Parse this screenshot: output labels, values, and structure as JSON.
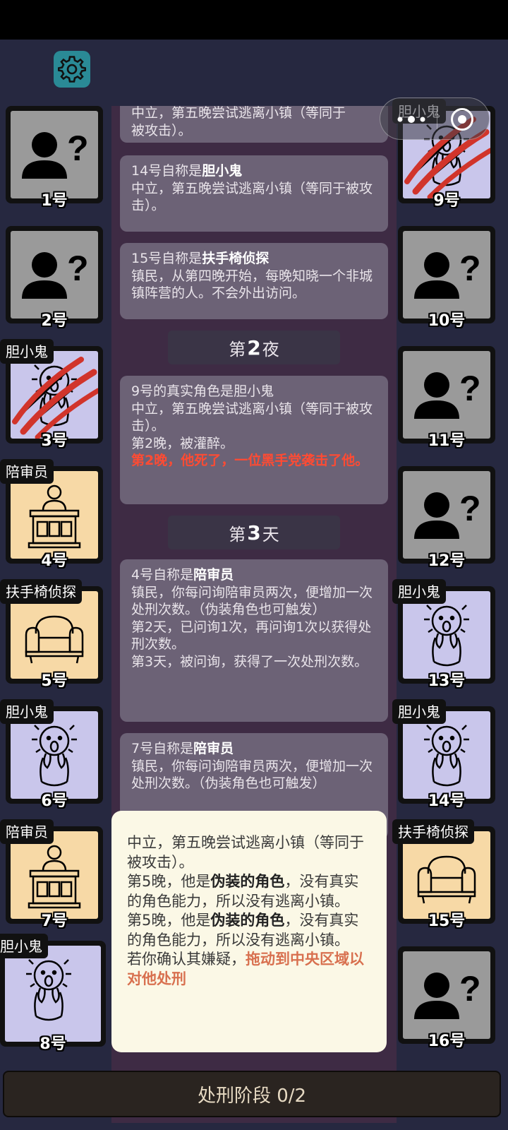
{
  "settings": {
    "icon": "gear-icon"
  },
  "capsule": {
    "more_icon": "more-dots-icon",
    "close_icon": "close-circle-icon"
  },
  "log": {
    "entry_top": {
      "line1": "中立，第五晚尝试逃离小镇（等同于",
      "line2": "被攻击）。"
    },
    "entry_14": {
      "prefix": "14号自称是",
      "role": "胆小鬼",
      "desc": "中立，第五晚尝试逃离小镇（等同于被攻击）。"
    },
    "entry_15": {
      "prefix": "15号自称是",
      "role": "扶手椅侦探",
      "desc": "镇民，从第四晚开始，每晚知晓一个非城镇阵营的人。不会外出访问。"
    },
    "night2": {
      "pre": "第",
      "num": "2",
      "post": "夜"
    },
    "entry_9": {
      "line1": "9号的真实角色是胆小鬼",
      "desc": "中立，第五晚尝试逃离小镇（等同于被攻击）。",
      "line3": "第2晚，被灌醉。",
      "red": "第2晚，他死了，一位黑手党袭击了他。"
    },
    "day3": {
      "pre": "第",
      "num": "3",
      "post": "天"
    },
    "entry_4": {
      "prefix": "4号自称是",
      "role": "陪审员",
      "desc": "镇民，你每问询陪审员两次，便增加一次处刑次数。（伪装角色也可触发）",
      "line3": "第2天，已问询1次，再问询1次以获得处刑次数。",
      "line4": "第3天，被问询，获得了一次处刑次数。"
    },
    "entry_7": {
      "prefix": "7号自称是",
      "role": "陪审员",
      "desc": "镇民，你每问询陪审员两次，便增加一次处刑次数。（伪装角色也可触发）"
    }
  },
  "players": [
    {
      "num": "1号",
      "tag": "",
      "type": "unknown"
    },
    {
      "num": "2号",
      "tag": "",
      "type": "unknown"
    },
    {
      "num": "3号",
      "tag": "胆小鬼",
      "type": "coward",
      "dead": true
    },
    {
      "num": "4号",
      "tag": "陪审员",
      "type": "juror"
    },
    {
      "num": "5号",
      "tag": "扶手椅侦探",
      "type": "armchair"
    },
    {
      "num": "6号",
      "tag": "胆小鬼",
      "type": "coward"
    },
    {
      "num": "7号",
      "tag": "陪审员",
      "type": "juror"
    },
    {
      "num": "8号",
      "tag": "胆小鬼",
      "type": "coward",
      "selected": true
    },
    {
      "num": "9号",
      "tag": "胆小鬼",
      "type": "coward",
      "dead": true
    },
    {
      "num": "10号",
      "tag": "",
      "type": "unknown"
    },
    {
      "num": "11号",
      "tag": "",
      "type": "unknown"
    },
    {
      "num": "12号",
      "tag": "",
      "type": "unknown"
    },
    {
      "num": "13号",
      "tag": "胆小鬼",
      "type": "coward"
    },
    {
      "num": "14号",
      "tag": "胆小鬼",
      "type": "coward"
    },
    {
      "num": "15号",
      "tag": "扶手椅侦探",
      "type": "armchair"
    },
    {
      "num": "16号",
      "tag": "",
      "type": "unknown"
    }
  ],
  "popup": {
    "line1": "中立，第五晚尝试逃离小镇（等同于被攻击）。",
    "p2_pre": "第5晚，他是",
    "p2_bold": "伪装的角色",
    "p2_post": "，没有真实的角色能力，所以没有逃离小镇。",
    "p3_pre": "第5晚，他是",
    "p3_bold": "伪装的角色",
    "p3_post": "，没有真实的角色能力，所以没有逃离小镇。",
    "p4_pre": "若你确认其嫌疑，",
    "p4_action": "拖动到中央区域以对他处刑"
  },
  "bottom": {
    "label": "处刑阶段 0/2"
  }
}
